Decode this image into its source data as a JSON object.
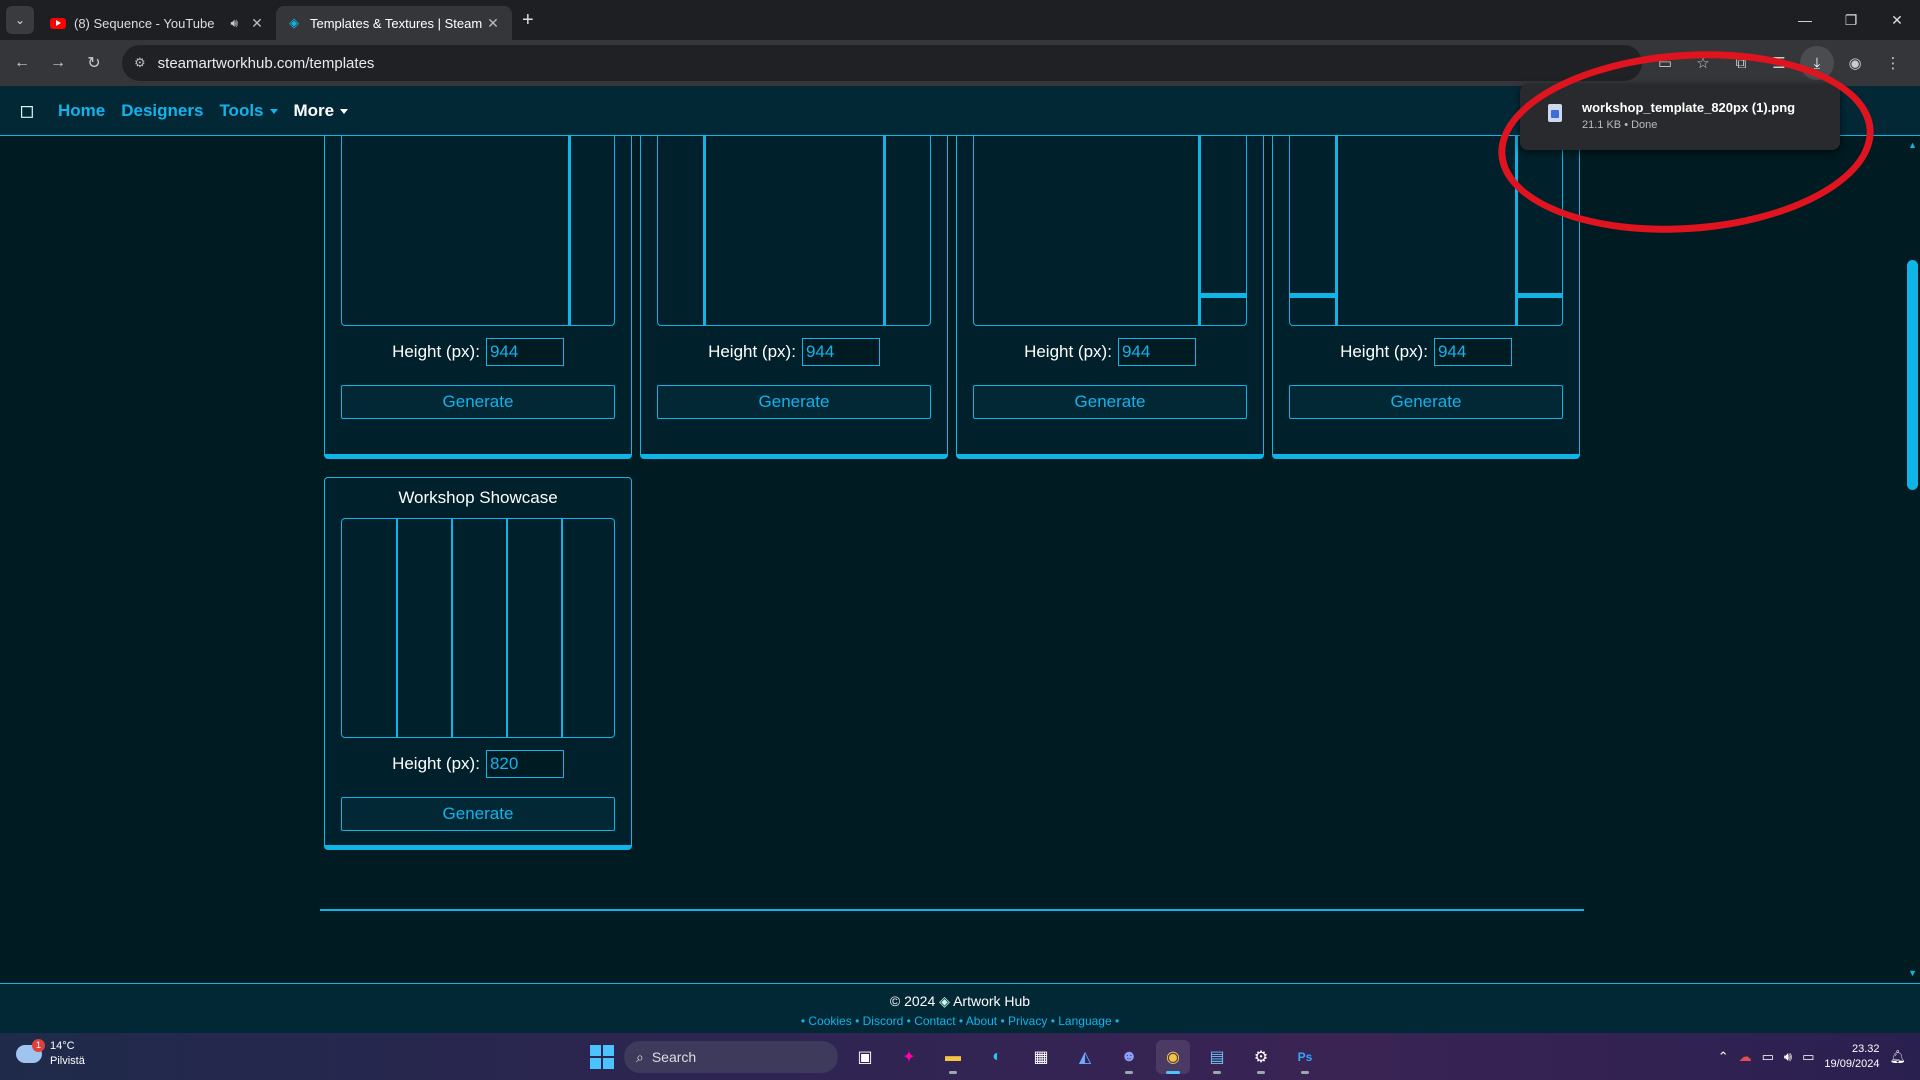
{
  "browser": {
    "tabs": [
      {
        "title": "(8) Sequence - YouTube",
        "active": false
      },
      {
        "title": "Templates & Textures | Steam A",
        "active": true
      }
    ],
    "url": "steamartworkhub.com/templates"
  },
  "nav": {
    "items": [
      {
        "label": "Home"
      },
      {
        "label": "Designers"
      },
      {
        "label": "Tools"
      },
      {
        "label": "More"
      }
    ]
  },
  "cards": [
    {
      "height_label": "Height (px):",
      "height_value": "944",
      "button": "Generate"
    },
    {
      "height_label": "Height (px):",
      "height_value": "944",
      "button": "Generate"
    },
    {
      "height_label": "Height (px):",
      "height_value": "944",
      "button": "Generate"
    },
    {
      "height_label": "Height (px):",
      "height_value": "944",
      "button": "Generate"
    },
    {
      "title": "Workshop Showcase",
      "height_label": "Height (px):",
      "height_value": "820",
      "button": "Generate"
    }
  ],
  "footer": {
    "copyright": "© 2024",
    "brand": "Artwork Hub",
    "links": [
      "Cookies",
      "Discord",
      "Contact",
      "About",
      "Privacy",
      "Language"
    ]
  },
  "download": {
    "filename": "workshop_template_820px (1).png",
    "meta": "21.1 KB • Done"
  },
  "taskbar": {
    "weather_temp": "14°C",
    "weather_desc": "Pilvistä",
    "weather_badge": "1",
    "search_label": "Search",
    "time": "23.32",
    "date": "19/09/2024"
  },
  "colors": {
    "accent": "#0fb5e6",
    "background": "#001b22",
    "annotation": "#e0141e"
  }
}
